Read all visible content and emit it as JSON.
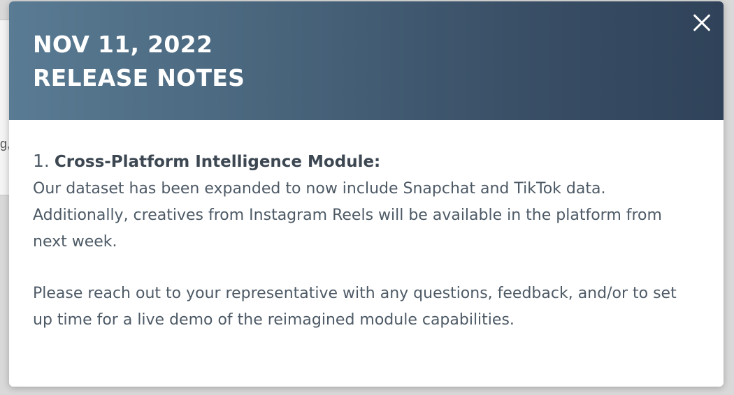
{
  "background": {
    "fragment_text": "g,"
  },
  "modal": {
    "header": {
      "date": "NOV 11, 2022",
      "title": "RELEASE NOTES",
      "close_icon": "close-icon"
    },
    "items": [
      {
        "number": "1.",
        "title": "Cross-Platform Intelligence Module:",
        "text": "Our dataset has been expanded to now include Snapchat and TikTok data. Additionally, creatives from Instagram Reels will be available in the platform from next week."
      }
    ],
    "closing": "Please reach out to your representative with any questions, feedback, and/or to set up time for a live demo of the reimagined module capabilities."
  },
  "colors": {
    "header_gradient_start": "#597b93",
    "header_gradient_end": "#2f4259",
    "body_text": "#4d5a66",
    "modal_background": "#ffffff"
  }
}
